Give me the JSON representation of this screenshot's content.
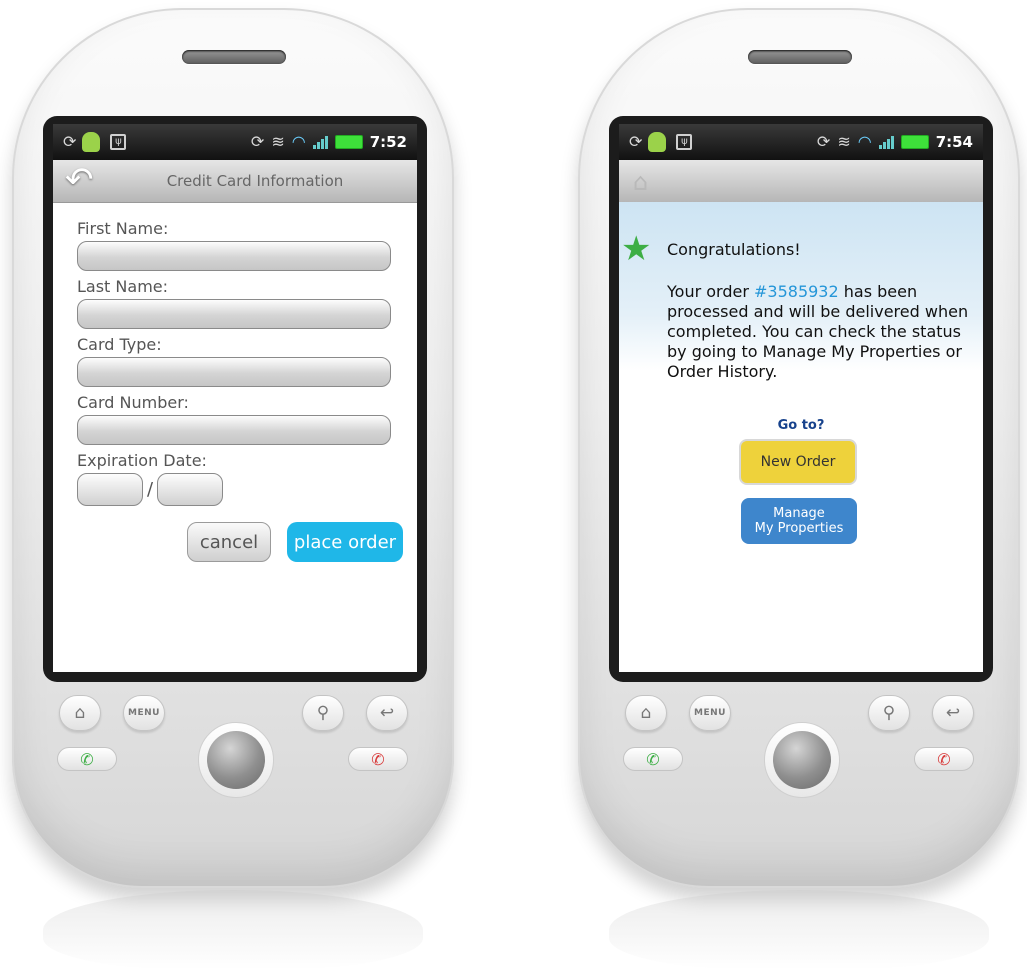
{
  "left_phone": {
    "status": {
      "time": "7:52"
    },
    "header": {
      "title": "Credit Card Information"
    },
    "form": {
      "first_name_label": "First Name:",
      "last_name_label": "Last Name:",
      "card_type_label": "Card Type:",
      "card_number_label": "Card Number:",
      "expiration_label": "Expiration Date:",
      "separator": "/"
    },
    "buttons": {
      "cancel": "cancel",
      "place_order": "place order"
    }
  },
  "right_phone": {
    "status": {
      "time": "7:54"
    },
    "confirmation": {
      "heading": "Congratulations!",
      "message_prefix": "Your order ",
      "order_number": "#3585932",
      "message_suffix": " has been processed and will be delivered when completed. You can check the status by going to Manage My Properties or Order History.",
      "goto_label": "Go to?",
      "new_order_label": "New Order",
      "manage_label_line1": "Manage",
      "manage_label_line2": "My Properties"
    }
  },
  "hardware": {
    "menu_label": "MENU"
  },
  "colors": {
    "place_order_button": "#1fb7e8",
    "new_order_button": "#eed23b",
    "manage_button": "#3e86cc",
    "link": "#2596d8",
    "star": "#3dae45",
    "goto_text": "#17428c"
  },
  "icons": {
    "status_left": [
      "sync-icon",
      "android-icon",
      "usb-icon"
    ],
    "status_right": [
      "sync-icon",
      "vibrate-icon",
      "wifi-icon",
      "signal-icon",
      "battery-icon"
    ],
    "hardware": [
      "home-icon",
      "search-icon",
      "back-icon",
      "call-icon",
      "end-call-icon"
    ]
  }
}
